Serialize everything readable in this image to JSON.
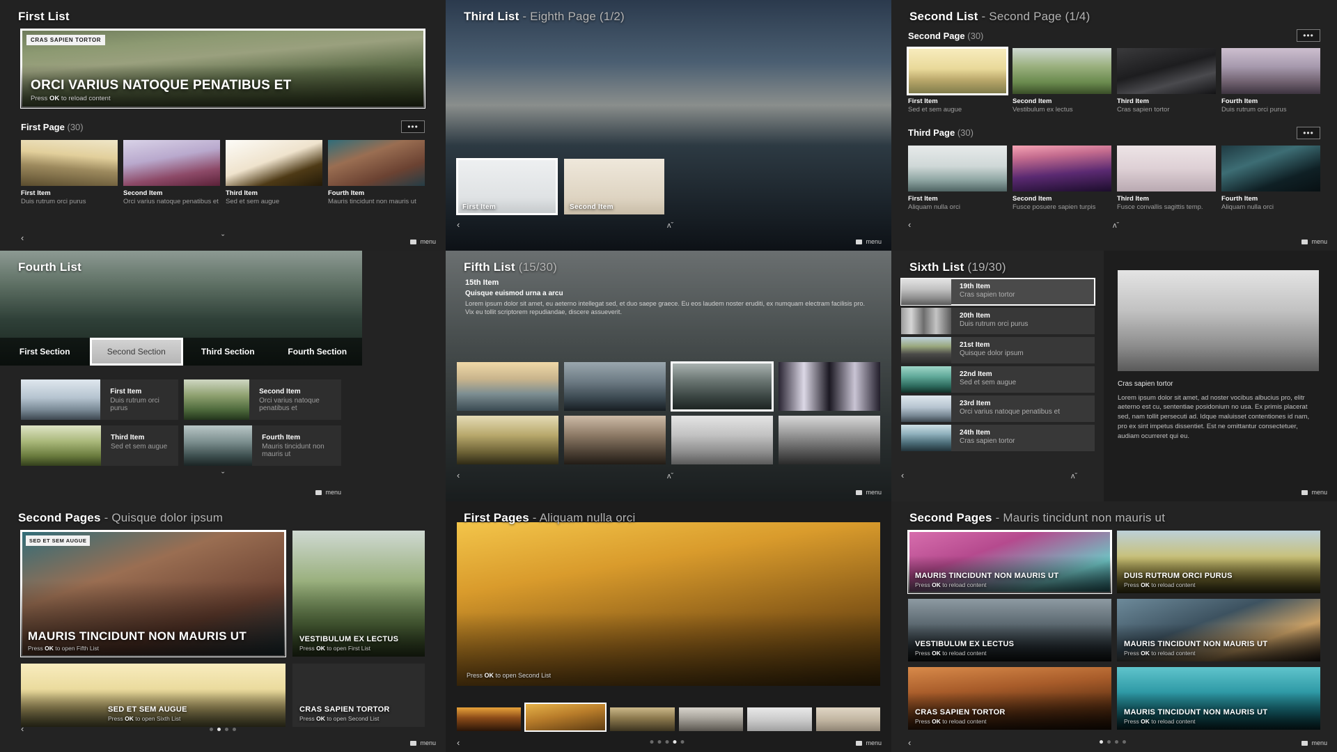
{
  "panel1": {
    "title": "First List",
    "hero": {
      "badge": "CRAS SAPIEN TORTOR",
      "headline": "ORCI VARIUS NATOQUE PENATIBUS ET",
      "hint_pre": "Press ",
      "hint_key": "OK",
      "hint_post": " to reload content"
    },
    "section": {
      "label": "First Page",
      "count": "(30)",
      "more": "•••"
    },
    "items": [
      {
        "title": "First Item",
        "subtitle": "Duis rutrum orci purus"
      },
      {
        "title": "Second Item",
        "subtitle": "Orci varius natoque penatibus et"
      },
      {
        "title": "Third Item",
        "subtitle": "Sed et sem augue"
      },
      {
        "title": "Fourth Item",
        "subtitle": "Mauris tincidunt non mauris ut"
      }
    ],
    "menu_label": "menu",
    "left_arrow": "‹",
    "down_arrow": "ˇ"
  },
  "panel2": {
    "title": "Third List",
    "subtitle": "- Eighth Page (1/2)",
    "items": [
      {
        "title": "First Item"
      },
      {
        "title": "Second Item"
      }
    ],
    "menu_label": "menu",
    "left_arrow": "‹",
    "updown": "ʌˇ"
  },
  "panel3": {
    "title": "Second List",
    "subtitle": "- Second Page (1/4)",
    "sections": [
      {
        "label": "Second Page",
        "count": "(30)",
        "more": "•••",
        "items": [
          {
            "title": "First Item",
            "subtitle": "Sed et sem augue"
          },
          {
            "title": "Second Item",
            "subtitle": "Vestibulum ex lectus"
          },
          {
            "title": "Third Item",
            "subtitle": "Cras sapien tortor"
          },
          {
            "title": "Fourth Item",
            "subtitle": "Duis rutrum orci purus"
          }
        ]
      },
      {
        "label": "Third Page",
        "count": "(30)",
        "more": "•••",
        "items": [
          {
            "title": "First Item",
            "subtitle": "Aliquam nulla orci"
          },
          {
            "title": "Second Item",
            "subtitle": "Fusce posuere sapien turpis"
          },
          {
            "title": "Third Item",
            "subtitle": "Fusce convallis sagittis temp."
          },
          {
            "title": "Fourth Item",
            "subtitle": "Aliquam nulla orci"
          }
        ]
      }
    ],
    "menu_label": "menu",
    "left_arrow": "‹",
    "updown": "ʌˇ"
  },
  "panel4": {
    "title": "Fourth List",
    "tabs": [
      {
        "label": "First Section",
        "selected": false
      },
      {
        "label": "Second Section",
        "selected": true
      },
      {
        "label": "Third Section",
        "selected": false
      },
      {
        "label": "Fourth Section",
        "selected": false
      }
    ],
    "items": [
      {
        "title": "First Item",
        "subtitle": "Duis rutrum orci purus"
      },
      {
        "title": "Second Item",
        "subtitle": "Orci varius natoque penatibus et"
      },
      {
        "title": "Third Item",
        "subtitle": "Sed et sem augue"
      },
      {
        "title": "Fourth Item",
        "subtitle": "Mauris tincidunt non mauris ut"
      }
    ],
    "menu_label": "menu",
    "down_arrow": "ˇ"
  },
  "panel5": {
    "title": "Fifth List",
    "count": "(15/30)",
    "detail": {
      "item_no": "15th Item",
      "heading": "Quisque euismod urna a arcu",
      "body": "Lorem ipsum dolor sit amet, eu aeterno intellegat sed, et duo saepe graece. Eu eos laudem noster eruditi, ex numquam electram facilisis pro. Vix eu tollit scriptorem repudiandae, discere assueverit."
    },
    "menu_label": "menu",
    "left_arrow": "‹",
    "updown": "ʌˇ"
  },
  "panel6": {
    "title": "Sixth List",
    "count": "(19/30)",
    "items": [
      {
        "title": "19th Item",
        "subtitle": "Cras sapien tortor",
        "selected": true
      },
      {
        "title": "20th Item",
        "subtitle": "Duis rutrum orci purus",
        "selected": false
      },
      {
        "title": "21st Item",
        "subtitle": "Quisque dolor ipsum",
        "selected": false
      },
      {
        "title": "22nd Item",
        "subtitle": "Sed et sem augue",
        "selected": false
      },
      {
        "title": "23rd Item",
        "subtitle": "Orci varius natoque penatibus et",
        "selected": false
      },
      {
        "title": "24th Item",
        "subtitle": "Cras sapien tortor",
        "selected": false
      }
    ],
    "detail": {
      "caption": "Cras sapien tortor",
      "body": "Lorem ipsum dolor sit amet, ad noster vocibus albucius pro, elitr aeterno est cu, sententiae posidonium no usa. Ex primis placerat sed, nam tollit persecuti ad. Idque maluisset contentiones id nam, pro ex sint impetus dissentiet. Est ne omittantur consectetuer, audiam ocurreret qui eu."
    },
    "menu_label": "menu",
    "left_arrow": "‹",
    "updown": "ʌˇ"
  },
  "panel7": {
    "title": "Second Pages",
    "subtitle": "- Quisque dolor ipsum",
    "hero": {
      "badge": "SED ET SEM AUGUE",
      "headline": "MAURIS TINCIDUNT NON MAURIS UT",
      "hint_pre": "Press ",
      "hint_key": "OK",
      "hint_post": " to open Fifth List"
    },
    "tiles": [
      {
        "headline": "VESTIBULUM EX LECTUS",
        "hint_pre": "Press ",
        "hint_key": "OK",
        "hint_post": " to open First List"
      },
      {
        "headline": "SED ET SEM AUGUE",
        "hint_pre": "Press ",
        "hint_key": "OK",
        "hint_post": " to open Sixth List"
      },
      {
        "headline": "CRAS SAPIEN TORTOR",
        "hint_pre": "Press ",
        "hint_key": "OK",
        "hint_post": " to open Second List"
      }
    ],
    "menu_label": "menu",
    "left_arrow": "‹",
    "pager": [
      false,
      true,
      false,
      false
    ]
  },
  "panel8": {
    "title": "First Pages",
    "subtitle": "- Aliquam nulla orci",
    "hero": {
      "hint_pre": "Press ",
      "hint_key": "OK",
      "hint_post": " to open Second List"
    },
    "menu_label": "menu",
    "left_arrow": "‹",
    "pager": [
      false,
      false,
      false,
      true,
      false
    ]
  },
  "panel9": {
    "title": "Second Pages",
    "subtitle": "- Mauris tincidunt non mauris ut",
    "tiles": [
      {
        "headline": "MAURIS TINCIDUNT NON MAURIS UT",
        "hint_pre": "Press ",
        "hint_key": "OK",
        "hint_post": " to reload content",
        "selected": true
      },
      {
        "headline": "DUIS RUTRUM ORCI PURUS",
        "hint_pre": "Press ",
        "hint_key": "OK",
        "hint_post": " to reload content",
        "selected": false
      },
      {
        "headline": "VESTIBULUM EX LECTUS",
        "hint_pre": "Press ",
        "hint_key": "OK",
        "hint_post": " to reload content",
        "selected": false
      },
      {
        "headline": "MAURIS TINCIDUNT NON MAURIS UT",
        "hint_pre": "Press ",
        "hint_key": "OK",
        "hint_post": " to reload content",
        "selected": false
      },
      {
        "headline": "CRAS SAPIEN TORTOR",
        "hint_pre": "Press ",
        "hint_key": "OK",
        "hint_post": " to reload content",
        "selected": false
      },
      {
        "headline": "MAURIS TINCIDUNT NON MAURIS UT",
        "hint_pre": "Press ",
        "hint_key": "OK",
        "hint_post": " to reload content",
        "selected": false
      }
    ],
    "menu_label": "menu",
    "left_arrow": "‹",
    "pager": [
      true,
      false,
      false,
      false
    ]
  }
}
